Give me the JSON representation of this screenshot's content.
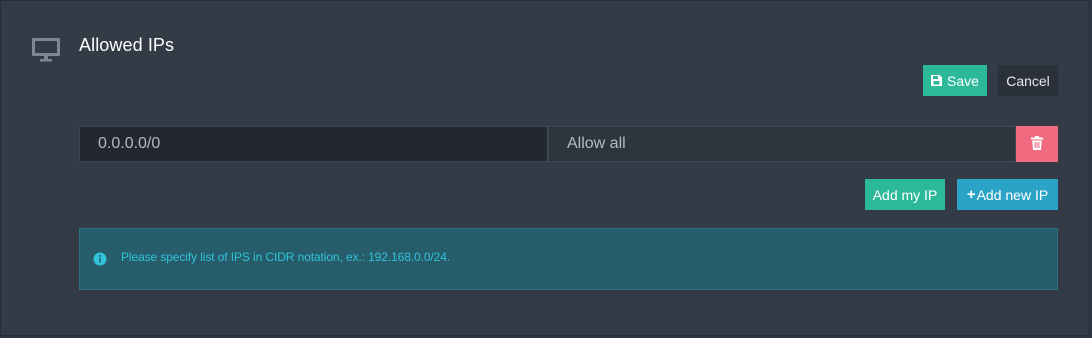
{
  "header": {
    "title": "Allowed IPs",
    "icon": "monitor-icon"
  },
  "toolbar": {
    "save_label": "Save",
    "save_icon": "floppy-disk-icon",
    "cancel_label": "Cancel"
  },
  "ip_list": [
    {
      "ip_value": "0.0.0.0/0",
      "description_value": "Allow all"
    }
  ],
  "actions": {
    "delete_icon": "trash-icon",
    "add_my_ip_label": "Add my IP",
    "add_new_ip_plus": "+",
    "add_new_ip_label": "Add new IP"
  },
  "info": {
    "icon": "info-icon",
    "text": "Please specify list of IPS in CIDR notation, ex.: 192.168.0.0/24."
  },
  "colors": {
    "panel_background": "#323b46",
    "save_button": "#2bb99a",
    "cancel_button": "#2a313b",
    "delete_button": "#f06b80",
    "add_my_ip_button": "#2bb99a",
    "add_new_ip_button": "#2aa3c7",
    "info_background": "#275d6b",
    "info_text": "#30c3d9"
  }
}
